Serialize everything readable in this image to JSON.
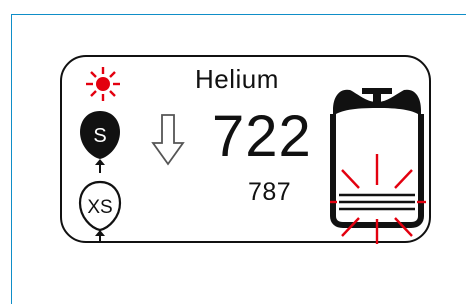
{
  "gas": {
    "name": "Helium",
    "value": "722",
    "secondary_value": "787"
  },
  "balloons": {
    "selected": {
      "label": "S"
    },
    "other": {
      "label": "XS"
    }
  },
  "icons": {
    "alert": "sun-burst-icon",
    "trend": "down-arrow-icon",
    "tank": "gas-cylinder-icon",
    "tank_alert": "cylinder-bottom-alert-icon"
  },
  "colors": {
    "frame": "#0f8ec8",
    "alert": "#e3000f",
    "ink": "#111111"
  }
}
